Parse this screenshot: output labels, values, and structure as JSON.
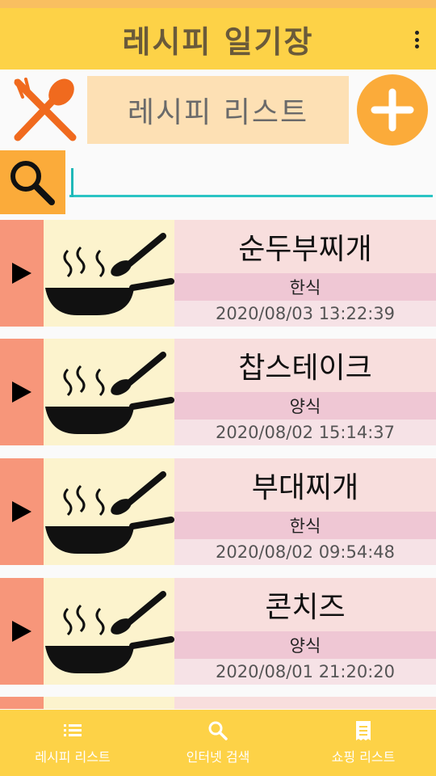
{
  "app": {
    "title": "레시피 일기장"
  },
  "header": {
    "list_title": "레시피 리스트"
  },
  "search": {
    "value": "",
    "placeholder": ""
  },
  "recipes": [
    {
      "name": "순두부찌개",
      "category": "한식",
      "date": "2020/08/03 13:22:39"
    },
    {
      "name": "찹스테이크",
      "category": "양식",
      "date": "2020/08/02 15:14:37"
    },
    {
      "name": "부대찌개",
      "category": "한식",
      "date": "2020/08/02 09:54:48"
    },
    {
      "name": "콘치즈",
      "category": "양식",
      "date": "2020/08/01 21:20:20"
    }
  ],
  "bottom_nav": [
    {
      "label": "레시피 리스트",
      "icon": "list-icon"
    },
    {
      "label": "인터넷 검색",
      "icon": "search-icon"
    },
    {
      "label": "쇼핑 리스트",
      "icon": "receipt-icon"
    }
  ],
  "colors": {
    "app_bar": "#fdd247",
    "accent_orange": "#fbab3a",
    "play_column": "#f7967a",
    "search_underline": "#2ac4c4"
  }
}
